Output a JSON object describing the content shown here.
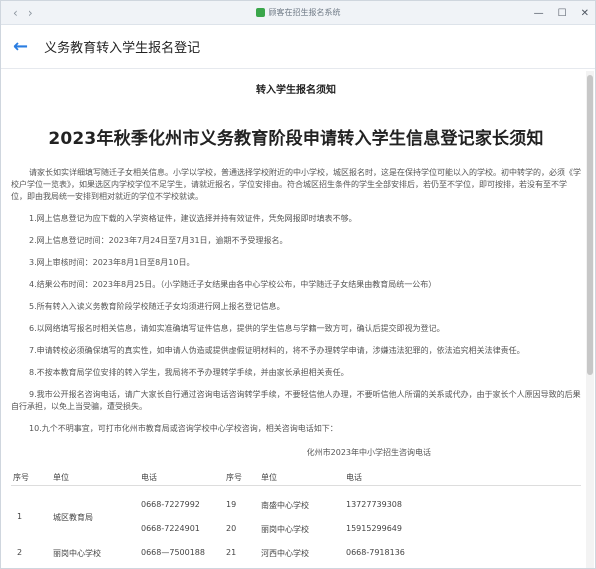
{
  "window": {
    "title": "顾客在招生报名系统",
    "back_arrow": "‹",
    "forward_arrow": "›",
    "minimize": "—",
    "maximize": "☐",
    "close": "✕"
  },
  "appbar": {
    "back": "←",
    "title": "义务教育转入学生报名登记"
  },
  "notice": {
    "heading": "转入学生报名须知",
    "main_title": "2023年秋季化州市义务教育阶段申请转入学生信息登记家长须知",
    "intro": "请家长如实详细填写随迁子女相关信息。小学以学校，普通选择学校附近的中小学校，城区报名时，这是在保持学位可能以入的学校。初中转学的，必须《学校户学位一览表》，如果选区内学校学位不足学生，请就近报名，学位安排由。符合城区招生条件的学生全部安排后，若仍至不学位，即可按排，若没有至不学位，即由我局统一安排到相对就近的学位不学校就读。",
    "items": [
      "1.网上信息登记为应下载的入学资格证件，建议选择并持有效证件，凭免网报即时填表不够。",
      "2.网上信息登记时间：2023年7月24日至7月31日，逾期不予受理报名。",
      "3.网上审核时间：2023年8月1日至8月10日。",
      "4.结果公布时间：2023年8月25日。（小学随迁子女结果由各中心学校公布，中学随迁子女结果由教育局统一公布）",
      "5.所有转入入读义务教育阶段学校随迁子女均须进行网上报名登记信息。",
      "6.以网络填写报名时相关信息，请如实准确填写证件信息，提供的学生信息与学籍一致方可，确认后提交即视为登记。",
      "7.申请转校必须确保填写的真实性，如申请人伪造或提供虚假证明材料的，将不予办理转学申请，涉嫌违法犯罪的，依法追究相关法律责任。",
      "8.不按本教育局学位安排的转入学生，我局将不予办理转学手续，并由家长承担相关责任。"
    ],
    "long_item": "9.我市公开报名咨询电话，请广大家长自行通过咨询电话咨询转学手续，不要轻信他人办理，不要听信他人所谓的关系或代办，由于家长个人原因导致的后果自行承担，以免上当受骗，遭受损失。",
    "last_item": "10.九个不明事宜，可打市化州市教育局或咨询学校中心学校咨询，相关咨询电话如下：",
    "table_caption": "化州市2023年中小学招生咨询电话"
  },
  "table": {
    "headers": [
      "序号",
      "单位",
      "电话",
      "序号",
      "单位",
      "电话"
    ],
    "rows": [
      [
        "",
        "",
        "0668-7227992",
        "19",
        "南盛中心学校",
        "13727739308"
      ],
      [
        "1",
        "城区教育局",
        "",
        "",
        "",
        ""
      ],
      [
        "",
        "",
        "0668-7224901",
        "20",
        "丽岗中心学校",
        "15915299649"
      ],
      [
        "2",
        "丽岗中心学校",
        "0668—7500188",
        "21",
        "河西中心学校",
        "0668-7918136"
      ]
    ]
  }
}
